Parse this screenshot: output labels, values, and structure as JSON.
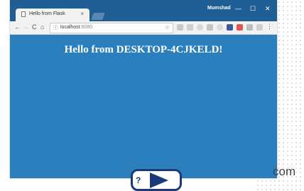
{
  "tab": {
    "title": "Hello from Flask",
    "close": "×"
  },
  "window": {
    "profile": "Mumshad",
    "minimize": "—",
    "maximize": "☐",
    "close": "✕"
  },
  "toolbar": {
    "back": "←",
    "forward": "→",
    "reload": "C",
    "home": "⌂",
    "url_host": "localhost",
    "url_port": ":8080",
    "info_icon": "ⓘ",
    "bookmark_star": "☆",
    "menu": "⋮"
  },
  "page": {
    "heading": "Hello from DESKTOP-4CJKELD!"
  },
  "watermark": {
    "suffix": "com"
  },
  "colors": {
    "titlebar": "#1f5f96",
    "page_bg": "#2b7fbd",
    "heading_text": "#ffffff",
    "logo": "#1a3a7a"
  },
  "icons": [
    "page-icon",
    "back-arrow-icon",
    "forward-arrow-icon",
    "reload-icon",
    "home-icon",
    "info-icon",
    "star-icon",
    "menu-icon"
  ]
}
